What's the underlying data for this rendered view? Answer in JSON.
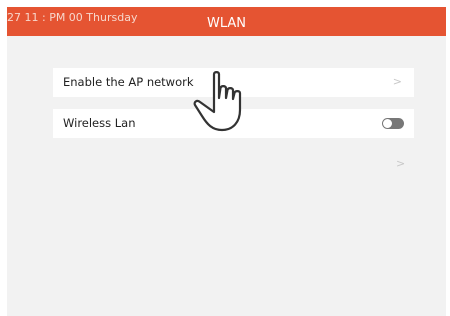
{
  "status_bar": {
    "time_text": "27 11 : PM 00 Thursday"
  },
  "header": {
    "title": "WLAN"
  },
  "settings": {
    "ap_network": {
      "label": "Enable the AP network",
      "chevron": ">"
    },
    "wireless_lan": {
      "label": "Wireless Lan",
      "toggle_on": false
    },
    "extra_chevron": ">"
  },
  "overlay": {
    "pointer_icon": "hand-pointer-icon"
  },
  "colors": {
    "header_bg": "#e55432",
    "screen_bg": "#f2f2f2",
    "row_bg": "#ffffff",
    "toggle_off": "#777777"
  }
}
